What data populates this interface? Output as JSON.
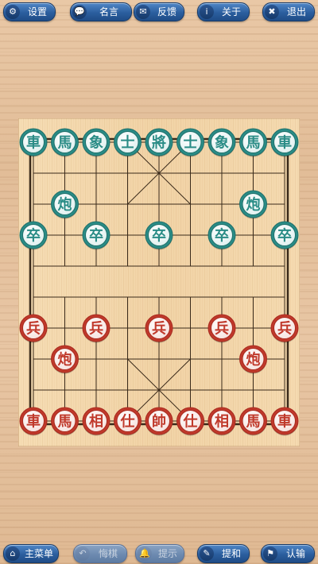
{
  "top_bar": {
    "buttons": [
      {
        "label": "设置",
        "icon": "gear-icon",
        "glyph": "⚙"
      },
      {
        "label": "名言",
        "icon": "speech-bubble-icon",
        "glyph": "💬"
      },
      {
        "label": "反馈",
        "icon": "envelope-icon",
        "glyph": "✉"
      },
      {
        "label": "关于",
        "icon": "info-icon",
        "glyph": "i"
      },
      {
        "label": "退出",
        "icon": "close-icon",
        "glyph": "✖"
      }
    ]
  },
  "bottom_bar": {
    "buttons": [
      {
        "label": "主菜单",
        "icon": "home-icon",
        "glyph": "⌂",
        "enabled": true
      },
      {
        "label": "悔棋",
        "icon": "undo-icon",
        "glyph": "↶",
        "enabled": false
      },
      {
        "label": "提示",
        "icon": "bell-icon",
        "glyph": "🔔",
        "enabled": false
      },
      {
        "label": "提和",
        "icon": "pencil-icon",
        "glyph": "✎",
        "enabled": true
      },
      {
        "label": "认输",
        "icon": "flag-icon",
        "glyph": "⚑",
        "enabled": true
      }
    ]
  },
  "board": {
    "files": 9,
    "ranks": 10,
    "colors": {
      "red_piece": "#c0392b",
      "red_ring": "#a82a1e",
      "teal_piece": "#2a8c86",
      "teal_ring": "#1f6f6a",
      "line": "#3a2a1a",
      "board_wood": "#f3d8ae"
    },
    "pieces": [
      {
        "side": "teal",
        "char": "車",
        "file": 0,
        "rank": 0
      },
      {
        "side": "teal",
        "char": "馬",
        "file": 1,
        "rank": 0
      },
      {
        "side": "teal",
        "char": "象",
        "file": 2,
        "rank": 0
      },
      {
        "side": "teal",
        "char": "士",
        "file": 3,
        "rank": 0
      },
      {
        "side": "teal",
        "char": "將",
        "file": 4,
        "rank": 0
      },
      {
        "side": "teal",
        "char": "士",
        "file": 5,
        "rank": 0
      },
      {
        "side": "teal",
        "char": "象",
        "file": 6,
        "rank": 0
      },
      {
        "side": "teal",
        "char": "馬",
        "file": 7,
        "rank": 0
      },
      {
        "side": "teal",
        "char": "車",
        "file": 8,
        "rank": 0
      },
      {
        "side": "teal",
        "char": "炮",
        "file": 1,
        "rank": 2
      },
      {
        "side": "teal",
        "char": "炮",
        "file": 7,
        "rank": 2
      },
      {
        "side": "teal",
        "char": "卒",
        "file": 0,
        "rank": 3
      },
      {
        "side": "teal",
        "char": "卒",
        "file": 2,
        "rank": 3
      },
      {
        "side": "teal",
        "char": "卒",
        "file": 4,
        "rank": 3
      },
      {
        "side": "teal",
        "char": "卒",
        "file": 6,
        "rank": 3
      },
      {
        "side": "teal",
        "char": "卒",
        "file": 8,
        "rank": 3
      },
      {
        "side": "red",
        "char": "兵",
        "file": 0,
        "rank": 6
      },
      {
        "side": "red",
        "char": "兵",
        "file": 2,
        "rank": 6
      },
      {
        "side": "red",
        "char": "兵",
        "file": 4,
        "rank": 6
      },
      {
        "side": "red",
        "char": "兵",
        "file": 6,
        "rank": 6
      },
      {
        "side": "red",
        "char": "兵",
        "file": 8,
        "rank": 6
      },
      {
        "side": "red",
        "char": "炮",
        "file": 1,
        "rank": 7
      },
      {
        "side": "red",
        "char": "炮",
        "file": 7,
        "rank": 7
      },
      {
        "side": "red",
        "char": "車",
        "file": 0,
        "rank": 9
      },
      {
        "side": "red",
        "char": "馬",
        "file": 1,
        "rank": 9
      },
      {
        "side": "red",
        "char": "相",
        "file": 2,
        "rank": 9
      },
      {
        "side": "red",
        "char": "仕",
        "file": 3,
        "rank": 9
      },
      {
        "side": "red",
        "char": "帥",
        "file": 4,
        "rank": 9
      },
      {
        "side": "red",
        "char": "仕",
        "file": 5,
        "rank": 9
      },
      {
        "side": "red",
        "char": "相",
        "file": 6,
        "rank": 9
      },
      {
        "side": "red",
        "char": "馬",
        "file": 7,
        "rank": 9
      },
      {
        "side": "red",
        "char": "車",
        "file": 8,
        "rank": 9
      }
    ]
  }
}
